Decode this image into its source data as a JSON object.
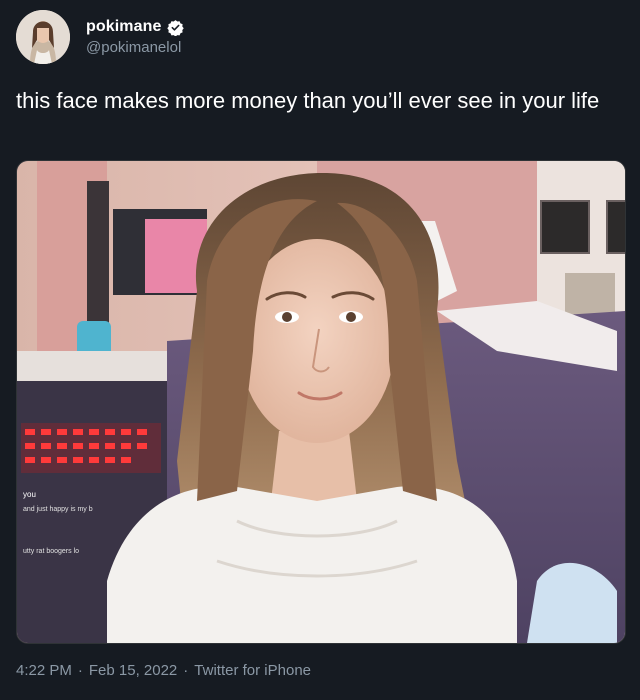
{
  "author": {
    "display_name": "pokimane",
    "handle": "@pokimanelol",
    "verified": true,
    "avatar_icon": "profile-photo"
  },
  "tweet": {
    "text": "this face makes more money than you’ll ever see in your life"
  },
  "media": {
    "kind": "photo",
    "overlay_texts": [
      "you",
      "and just happy is my b",
      "utty rat boogers lo"
    ]
  },
  "meta": {
    "time": "4:22 PM",
    "separator": "·",
    "date": "Feb 15, 2022",
    "source": "Twitter for iPhone"
  },
  "colors": {
    "background": "#161b22",
    "text": "#ffffff",
    "secondary_text": "#8b98a5",
    "verified_badge": "#ffffff"
  }
}
